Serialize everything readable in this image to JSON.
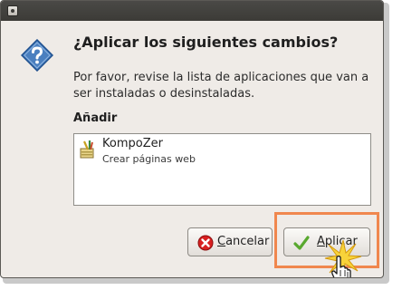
{
  "dialog": {
    "title": "¿Aplicar los siguientes cambios?",
    "description": "Por favor, revise la lista de aplicaciones que van a ser instaladas o desinstaladas.",
    "section_label": "Añadir",
    "items": [
      {
        "name": "KompoZer",
        "subtitle": "Crear páginas web",
        "icon": "web-editor-icon"
      }
    ],
    "buttons": {
      "cancel": "Cancelar",
      "apply": "Aplicar"
    },
    "icons": {
      "dialog": "question-icon",
      "cancel": "cancel-icon",
      "apply": "checkmark-icon",
      "window_menu": "window-menu-icon",
      "pointer": "hand-pointer-icon"
    },
    "colors": {
      "highlight": "#f0874e",
      "question": "#4a7fbf",
      "cancel": "#d82020",
      "apply": "#58a82e"
    }
  }
}
